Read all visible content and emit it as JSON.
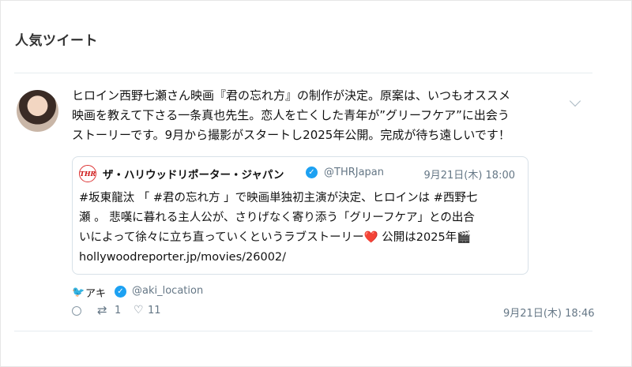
{
  "header": {
    "title": "人気ツイート"
  },
  "tweet": {
    "text": "ヒロイン西野七瀬さん映画『君の忘れ方』の制作が決定。原案は、いつもオススメ\n映画を教えて下さる一条真也先生。恋人を亡くした青年が”グリーフケア”に出会う\nストーリーです。9月から撮影がスタートし2025年公開。完成が待ち遠しいです！",
    "author_name": "アキ",
    "author_handle": "@aki_location",
    "date": "9月21日(木) 18:46",
    "retweets": "1",
    "likes": "11"
  },
  "quote": {
    "logo_text": "THR",
    "name": "ザ・ハリウッドリポーター・ジャパン",
    "handle": "@THRJapan",
    "date": "9月21日(木) 18:00",
    "body": "#坂東龍汰 「 #君の忘れ方 」で映画単独初主演が決定、ヒロインは #西野七\n瀬 。 悲嘆に暮れる主人公が、さりげなく寄り添う「グリーフケア」との出合\nいによって徐々に立ち直っていくというラブストーリー❤️ 公開は2025年🎬\nhollywoodreporter.jp/movies/26002/"
  },
  "icons": {
    "chevron": "chevron-down-icon",
    "verified": "verified-icon",
    "bird": "twitter-bird-icon",
    "reply": "reply-icon",
    "retweet": "retweet-icon",
    "like": "heart-icon"
  },
  "colors": {
    "accent": "#1da1f2",
    "muted": "#657786",
    "border": "#d8e1e8"
  }
}
